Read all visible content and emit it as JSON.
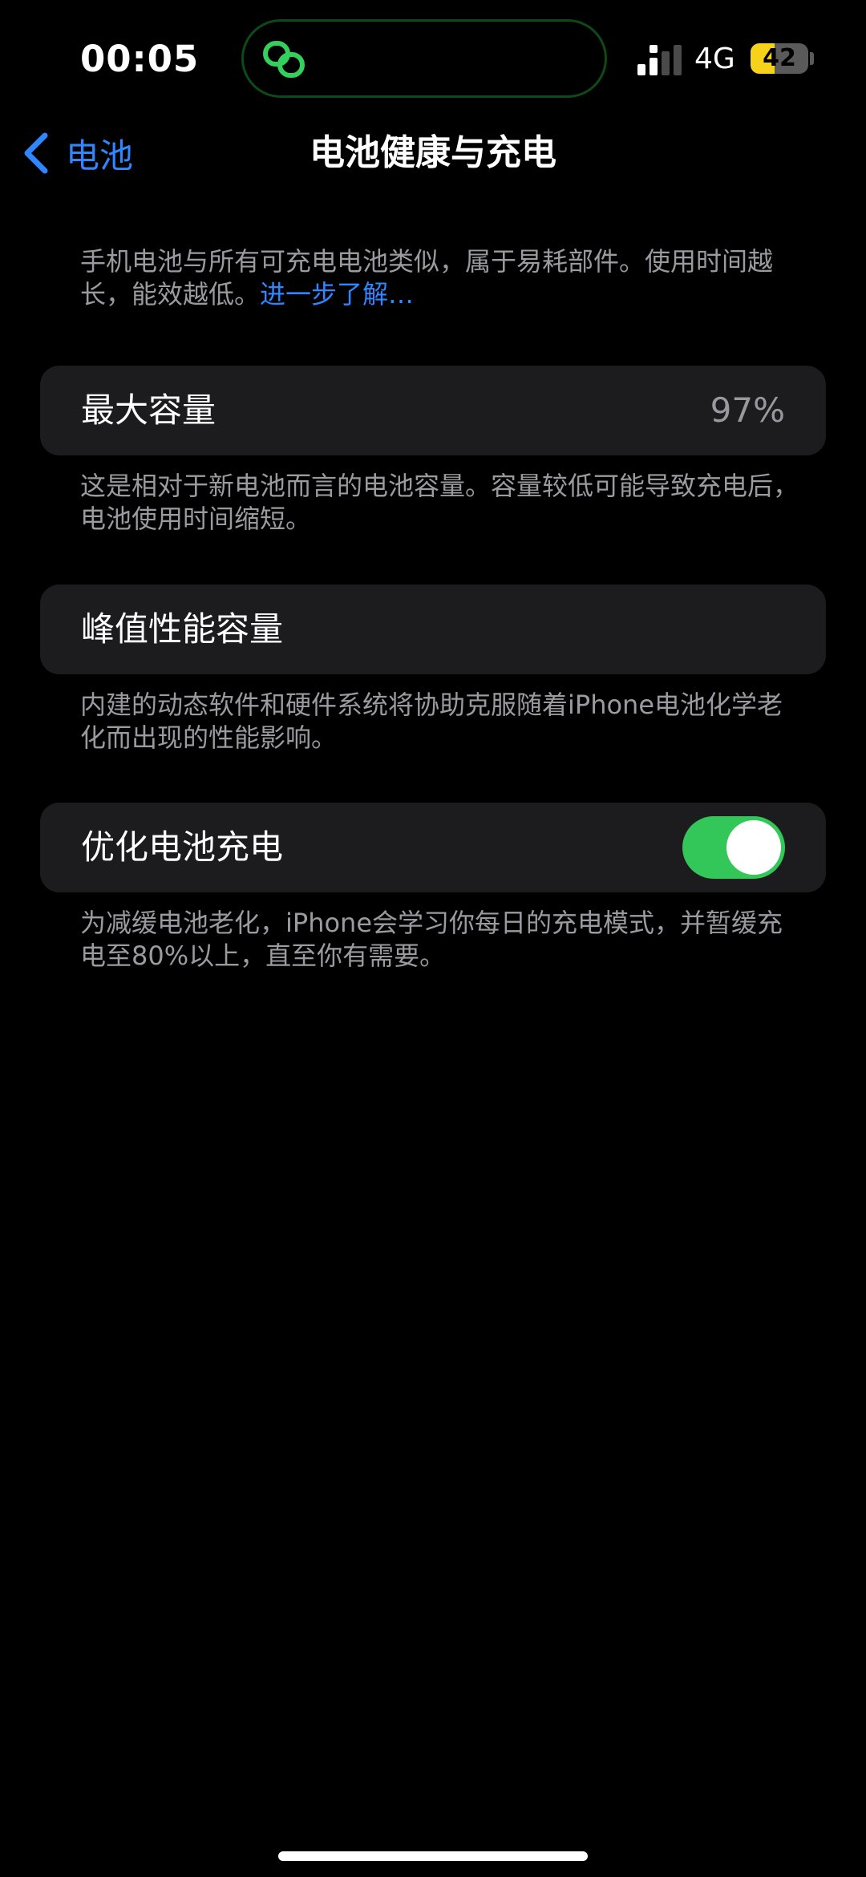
{
  "status_bar": {
    "time": "00:05",
    "network": "4G",
    "battery_level": "42",
    "battery_fraction": 0.42,
    "icons": {
      "island": "link-chain-icon",
      "signal": "cellular-signal-icon",
      "battery": "battery-icon"
    },
    "colors": {
      "island_icon": "#32d15c",
      "battery_fill": "#f6d21b"
    }
  },
  "nav": {
    "back_label": "电池",
    "title": "电池健康与充电",
    "back_icon": "chevron-left-icon"
  },
  "intro": {
    "text": "手机电池与所有可充电电池类似，属于易耗部件。使用时间越长，能效越低。",
    "link": "进一步了解…"
  },
  "sections": {
    "max_capacity": {
      "label": "最大容量",
      "value": "97%",
      "footer": "这是相对于新电池而言的电池容量。容量较低可能导致充电后，电池使用时间缩短。"
    },
    "peak_performance": {
      "label": "峰值性能容量",
      "footer": "内建的动态软件和硬件系统将协助克服随着iPhone电池化学老化而出现的性能影响。"
    },
    "optimized_charging": {
      "label": "优化电池充电",
      "enabled": true,
      "footer": "为减缓电池老化，iPhone会学习你每日的充电模式，并暂缓充电至80%以上，直至你有需要。"
    }
  },
  "colors": {
    "accent": "#2f86ff",
    "toggle_on": "#33c759",
    "card_bg": "#1c1c1e",
    "secondary_text": "#9a9aa0"
  }
}
